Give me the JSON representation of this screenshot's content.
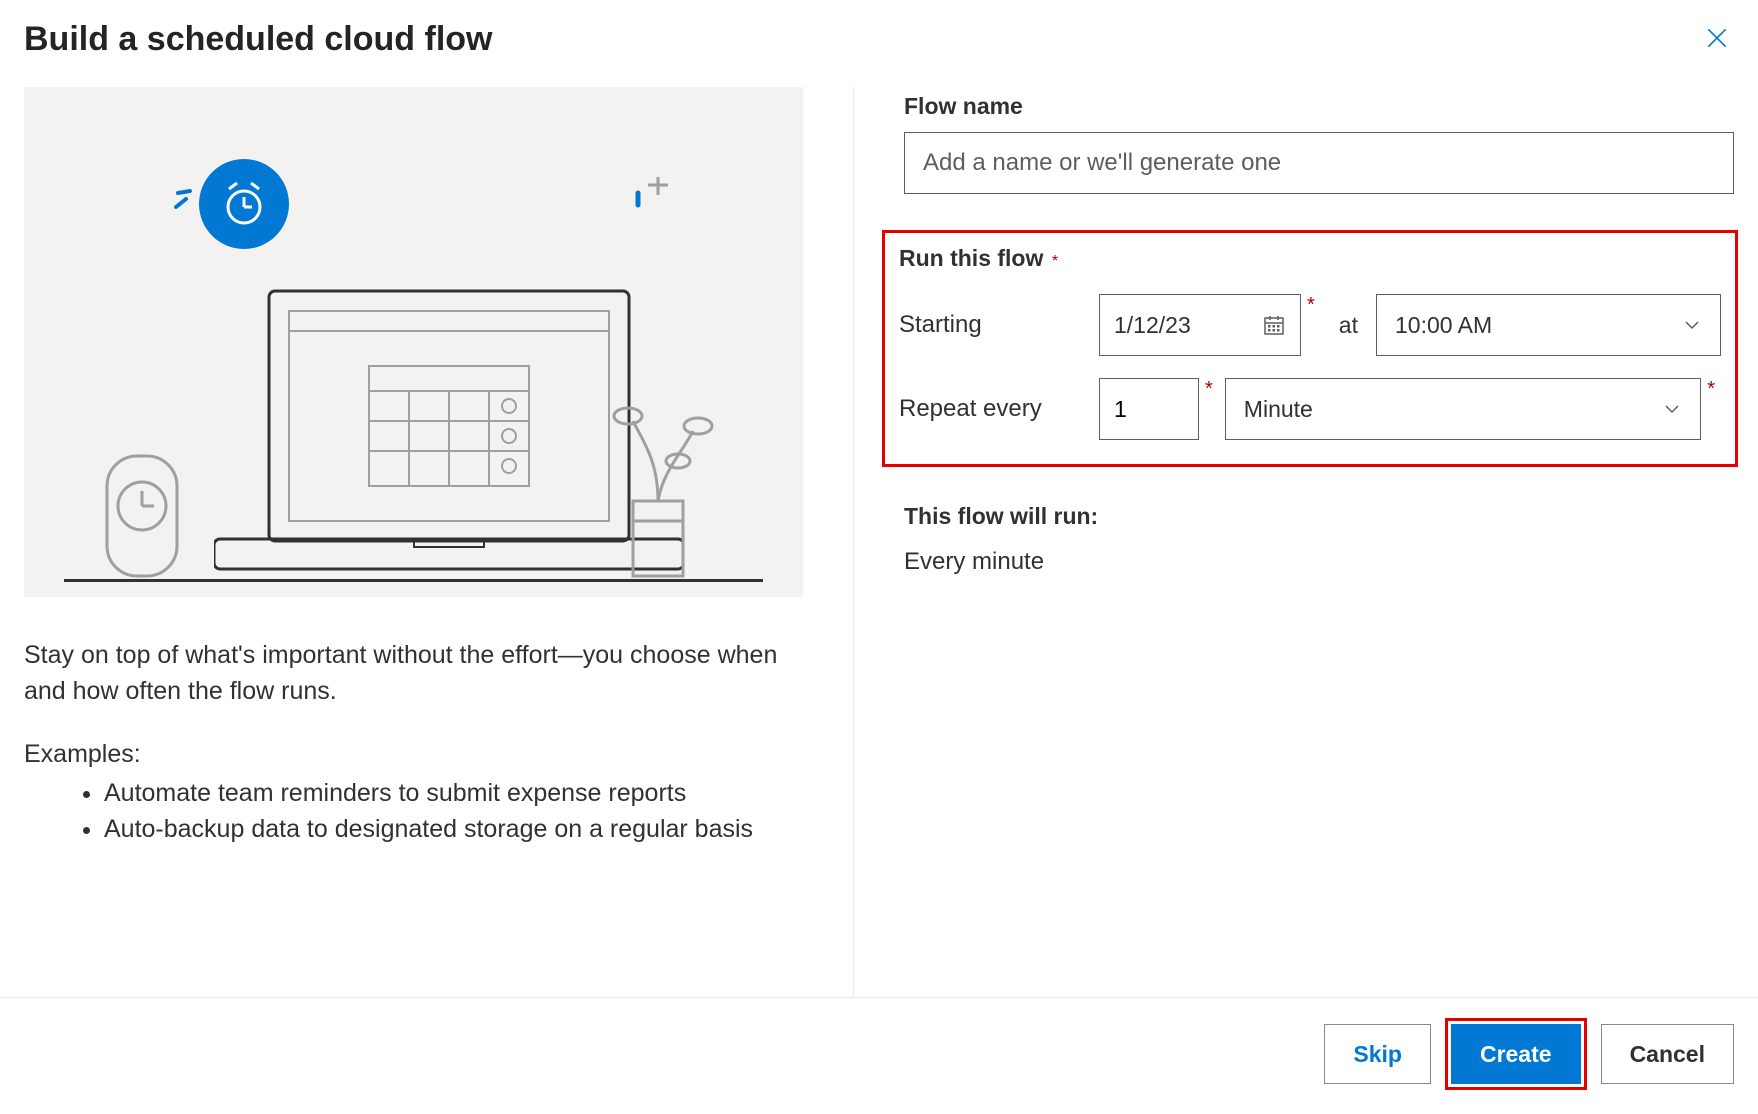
{
  "header": {
    "title": "Build a scheduled cloud flow"
  },
  "left": {
    "description": "Stay on top of what's important without the effort—you choose when and how often the flow runs.",
    "examples_label": "Examples:",
    "examples": [
      "Automate team reminders to submit expense reports",
      "Auto-backup data to designated storage on a regular basis"
    ]
  },
  "form": {
    "flow_name_label": "Flow name",
    "flow_name_placeholder": "Add a name or we'll generate one",
    "flow_name_value": "",
    "run_section_title": "Run this flow",
    "starting_label": "Starting",
    "start_date": "1/12/23",
    "at_label": "at",
    "start_time": "10:00 AM",
    "repeat_label": "Repeat every",
    "repeat_value": "1",
    "repeat_unit": "Minute",
    "summary_title": "This flow will run:",
    "summary_text": "Every minute"
  },
  "footer": {
    "skip": "Skip",
    "create": "Create",
    "cancel": "Cancel"
  },
  "colors": {
    "accent": "#0078d4",
    "highlight": "#e60000"
  }
}
